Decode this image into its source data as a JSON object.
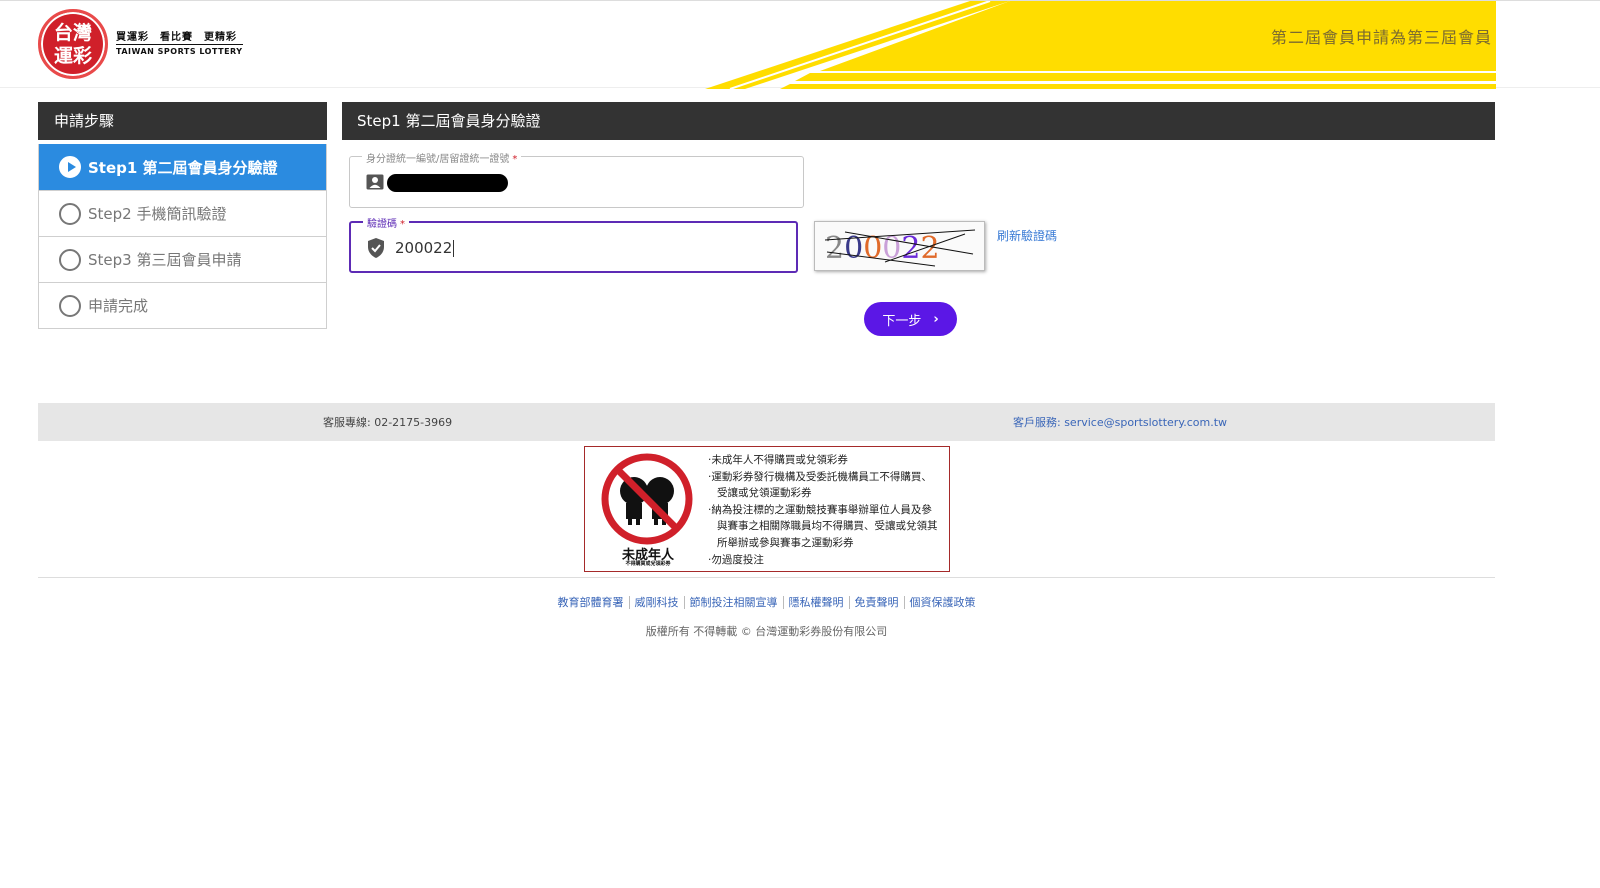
{
  "header": {
    "logo_text_line1": "台灣",
    "logo_text_line2": "運彩",
    "slogan": "買運彩　看比賽　更精彩",
    "slogan_en": "TAIWAN SPORTS LOTTERY",
    "page_title": "第二屆會員申請為第三屆會員"
  },
  "sidebar": {
    "title": "申請步驟",
    "steps": [
      {
        "label": "Step1 第二屆會員身分驗證",
        "active": true
      },
      {
        "label": "Step2 手機簡訊驗證",
        "active": false
      },
      {
        "label": "Step3 第三屆會員申請",
        "active": false
      },
      {
        "label": "申請完成",
        "active": false
      }
    ]
  },
  "main": {
    "title": "Step1 第二屆會員身分驗證",
    "id_field": {
      "label": "身分證統一編號/居留證統一證號"
    },
    "captcha_field": {
      "label": "驗證碼",
      "value": "200022"
    },
    "captcha_image_text": "200022",
    "refresh_label": "刷新驗證碼",
    "next_label": "下一步"
  },
  "service": {
    "tel": "客服專線: 02-2175-3969",
    "mail": "客戶服務: service@sportslottery.com.tw"
  },
  "warning": {
    "caption": "未成年人",
    "sub": "不得購買或兌領彩券",
    "lines": [
      "‧未成年人不得購買或兌領彩券",
      "‧運動彩券發行機構及受委託機構員工不得購買、受讓或兌領運動彩券",
      "‧納為投注標的之運動競技賽事舉辦單位人員及參與賽事之相關隊職員均不得購買、受讓或兌領其所舉辦或參與賽事之運動彩券",
      "‧勿過度投注"
    ]
  },
  "footer": {
    "links": [
      "教育部體育署",
      "威剛科技",
      "節制投注相關宣導",
      "隱私權聲明",
      "免責聲明",
      "個資保護政策"
    ],
    "copyright": "版權所有 不得轉載 © 台灣運動彩券股份有限公司"
  },
  "colors": {
    "brand_red": "#d0202a",
    "banner_yellow": "#ffdd00",
    "active_step": "#2b8be0",
    "primary_button": "#5b17e6",
    "focus_border": "#5d2bb5"
  }
}
